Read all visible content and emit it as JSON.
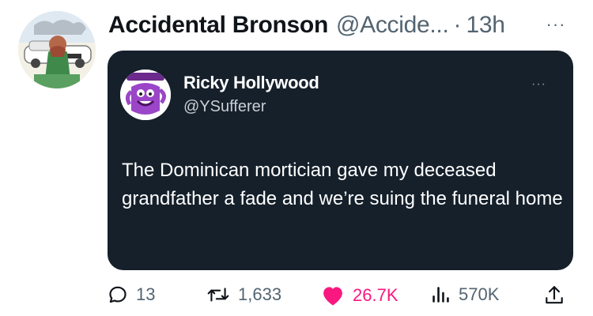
{
  "post": {
    "author_name": "Accidental Bronson",
    "author_handle": "@Accide...",
    "separator": "·",
    "time": "13h",
    "more": "···"
  },
  "quoted": {
    "author_name": "Ricky Hollywood",
    "author_handle": "@YSufferer",
    "more": "···",
    "text": "The Dominican mortician gave my deceased grandfather a fade and we’re suing the funeral home"
  },
  "actions": {
    "replies": "13",
    "reposts": "1,633",
    "likes": "26.7K",
    "views": "570K"
  },
  "colors": {
    "card_bg": "#15202b",
    "like": "#f91880",
    "muted": "#536471"
  }
}
